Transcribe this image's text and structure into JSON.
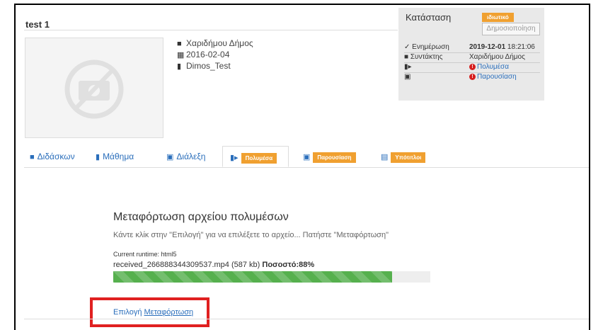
{
  "page": {
    "title": "test 1"
  },
  "meta": {
    "author": "Χαριδήμου Δήμος",
    "date": "2016-02-04",
    "course": "Dimos_Test"
  },
  "status_panel": {
    "label": "Κατάσταση",
    "badge": "ιδιωτικό",
    "publish_button": "Δημοσιοποίηση",
    "rows": [
      {
        "icon": "edit-icon",
        "key": "Ενημέρωση",
        "value_bold": "2019-12-01",
        "value": " 18:21:06"
      },
      {
        "icon": "user-icon",
        "key": "Συντάκτης",
        "value": "Χαριδήμου Δήμος"
      },
      {
        "icon": "video-icon",
        "key": "",
        "value": "Πολυμέσα"
      },
      {
        "icon": "image-icon",
        "key": "",
        "value": "Παρουσίαση"
      }
    ]
  },
  "tabs": [
    {
      "label": "Διδάσκων",
      "icon": "user-icon"
    },
    {
      "label": "Μάθημα",
      "icon": "book-icon"
    },
    {
      "label": "Διάλεξη",
      "icon": "presentation-icon"
    },
    {
      "label": "Πολυμέσα",
      "icon": "video-icon",
      "active": true
    },
    {
      "label": "Παρουσίαση",
      "icon": "image-icon"
    },
    {
      "label": "Υπότιτλοι",
      "icon": "subtitles-icon"
    }
  ],
  "upload": {
    "title": "Μεταφόρτωση αρχείου πολυμέσων",
    "hint": "Κάντε κλίκ στην \"Επιλογή\" για να επιλέξετε το αρχείο... Πατήστε \"Μεταφόρτωση\"",
    "runtime": "Current runtime: html5",
    "file": "received_266888344309537.mp4 (587 kb) ",
    "percent_label": "Ποσοστό:88%",
    "progress": 0.88,
    "select_link": "Επιλογή",
    "upload_link": "Μεταφόρτωση"
  },
  "colors": {
    "accent": "#f0a030",
    "link": "#2a6ebb",
    "progress": "#56b04e",
    "highlight": "#e02020"
  }
}
